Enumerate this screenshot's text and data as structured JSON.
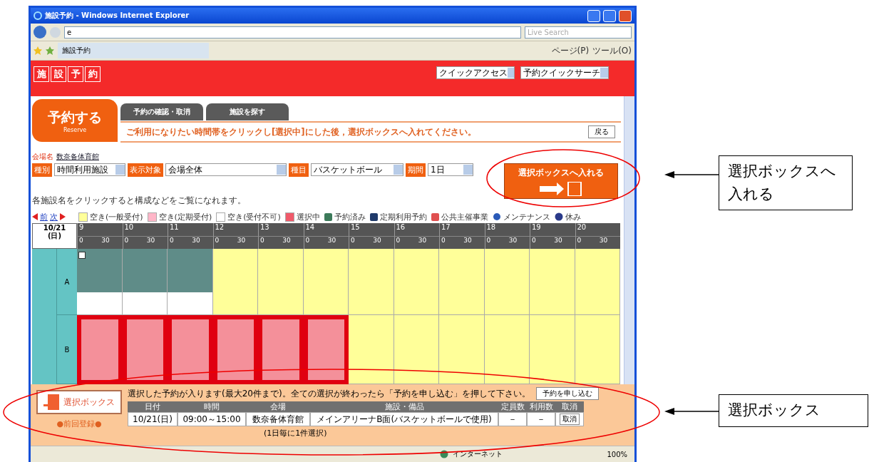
{
  "window": {
    "title": "施設予約 - Windows Internet Explorer"
  },
  "browser": {
    "address": "e",
    "search_placeholder": "Live Search",
    "tab": "施設予約",
    "toolbar": [
      "ページ(P)",
      "ツール(O)"
    ]
  },
  "site": {
    "logo_chars": [
      "施",
      "設",
      "予",
      "約"
    ],
    "quick_selects": [
      "クイックアクセス",
      "予約クイックサーチ"
    ]
  },
  "tabs": [
    {
      "label": "予約する",
      "sub": "Reserve",
      "selected": true
    },
    {
      "label": "予約の確認・取消",
      "selected": false
    },
    {
      "label": "施設を探す",
      "selected": false
    }
  ],
  "instruction": "ご利用になりたい時間帯をクリックし[選択中]にした後，選択ボックスへ入れてください。",
  "back_button": "戻る",
  "venue": {
    "label": "会場名",
    "name": "数奈备体育館"
  },
  "filters": [
    {
      "label": "種別",
      "value": "時間利用施設"
    },
    {
      "label": "表示対象",
      "value": "会場全体"
    },
    {
      "label": "種目",
      "value": "バスケットボール"
    },
    {
      "label": "期間",
      "value": "1日"
    }
  ],
  "add_button": "選択ボックスへ入れる",
  "hint": "各施設名をクリックすると構成などをご覧になれます。",
  "nav": [
    "前",
    "次"
  ],
  "legend": [
    {
      "kind": "swatch",
      "color": "#ffff99",
      "label": "空き(一般受付)"
    },
    {
      "kind": "swatch",
      "color": "#ffb6c8",
      "label": "空き(定期受付)"
    },
    {
      "kind": "swatch",
      "color": "#ffffff",
      "label": "空き(受付不可)"
    },
    {
      "kind": "swatch",
      "color": "#f05a6a",
      "label": "選択中"
    },
    {
      "kind": "icon",
      "color": "#3c7a5a",
      "label": "予約済み"
    },
    {
      "kind": "icon",
      "color": "#1f3a6a",
      "label": "定期利用予約"
    },
    {
      "kind": "icon",
      "color": "#e05050",
      "label": "公共主催事業"
    },
    {
      "kind": "gear",
      "color": "#2a5ab8",
      "label": "メンテナンス"
    },
    {
      "kind": "round",
      "color": "#2a3a8a",
      "label": "休み"
    }
  ],
  "grid": {
    "date": "10/21",
    "weekday": "(日)",
    "hours": [
      {
        "label": "9",
        "minutes": [
          "0",
          "30"
        ]
      },
      {
        "label": "10",
        "minutes": [
          "0",
          "30"
        ]
      },
      {
        "label": "11",
        "minutes": [
          "0",
          "30"
        ]
      },
      {
        "label": "12",
        "minutes": [
          "0",
          "30"
        ]
      },
      {
        "label": "13",
        "minutes": [
          "0",
          "30"
        ]
      },
      {
        "label": "14",
        "minutes": [
          "0",
          "30"
        ]
      },
      {
        "label": "15",
        "minutes": [
          "0",
          "30"
        ]
      },
      {
        "label": "16",
        "minutes": [
          "0",
          "30"
        ]
      },
      {
        "label": "17",
        "minutes": [
          "0",
          "30"
        ]
      },
      {
        "label": "18",
        "minutes": [
          "0",
          "30"
        ]
      },
      {
        "label": "19",
        "minutes": [
          "0",
          "30"
        ]
      },
      {
        "label": "20",
        "minutes": [
          "0",
          "30"
        ]
      }
    ],
    "rows": [
      {
        "court": "A",
        "cells": [
          {
            "kind": "reserved",
            "marked": true
          },
          {
            "kind": "reserved",
            "marked": false
          },
          {
            "kind": "reserved",
            "marked": false
          },
          {
            "kind": "open"
          },
          {
            "kind": "open"
          },
          {
            "kind": "open"
          },
          {
            "kind": "open"
          },
          {
            "kind": "open"
          },
          {
            "kind": "open"
          },
          {
            "kind": "open"
          },
          {
            "kind": "open"
          },
          {
            "kind": "open"
          }
        ]
      },
      {
        "court": "B",
        "cells": [
          {
            "kind": "selected"
          },
          {
            "kind": "selected"
          },
          {
            "kind": "selected"
          },
          {
            "kind": "selected"
          },
          {
            "kind": "selected"
          },
          {
            "kind": "selected"
          },
          {
            "kind": "open"
          },
          {
            "kind": "open"
          },
          {
            "kind": "open"
          },
          {
            "kind": "open"
          },
          {
            "kind": "open"
          },
          {
            "kind": "open"
          }
        ]
      }
    ]
  },
  "selection_box": {
    "button": "選択ボックス",
    "caption": "●前回登録●",
    "message": "選択した予約が入ります(最大20件まで)。全ての選択が終わったら「予約を申し込む」を押して下さい。",
    "submit": "予約を申し込む",
    "columns": [
      "日付",
      "時間",
      "会場",
      "施設・備品",
      "定員数",
      "利用数",
      "取消"
    ],
    "rows": [
      [
        "10/21(日)",
        "09:00～15:00",
        "数奈备体育館",
        "メインアリーナB面(バスケットボールで使用)",
        "－",
        "－"
      ]
    ],
    "cancel": "取消",
    "note": "(1日毎に1件選択)"
  },
  "status_bar": {
    "zone": "インターネット",
    "zoom": "100%"
  },
  "callouts": [
    "選択ボックスへ入れる",
    "選択ボックス"
  ]
}
